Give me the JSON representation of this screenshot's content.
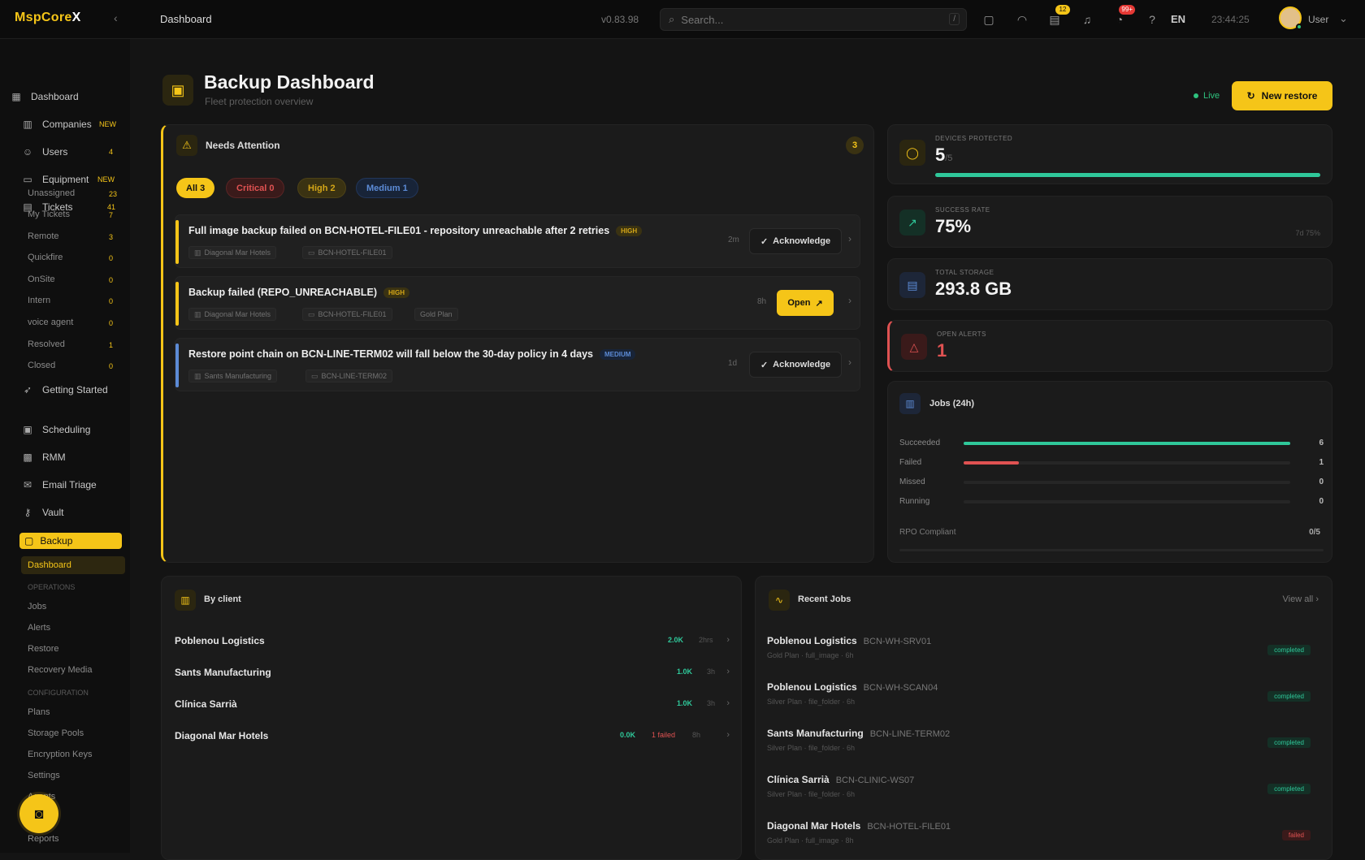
{
  "topbar": {
    "logo_prefix": "MspCore",
    "logo_suffix": "X",
    "breadcrumb": "Dashboard",
    "version": "v0.83.98",
    "search_placeholder": "Search...",
    "search_shortcut": "/",
    "badge_tickets": "12",
    "badge_alerts": "99+",
    "language": "EN",
    "clock": "23:44:25",
    "user": "User"
  },
  "sidebar": {
    "dashboard": "Dashboard",
    "companies": "Companies",
    "companies_count": "NEW",
    "users": "Users",
    "users_count": "4",
    "equipment": "Equipment",
    "equipment_count": "NEW",
    "tickets": "Tickets",
    "tickets_count": "41",
    "ticket_subs": [
      {
        "label": "Unassigned",
        "count": "23"
      },
      {
        "label": "My Tickets",
        "count": "7"
      },
      {
        "label": "Remote",
        "count": "3"
      },
      {
        "label": "Quickfire",
        "count": "0"
      },
      {
        "label": "OnSite",
        "count": "0"
      },
      {
        "label": "Intern",
        "count": "0"
      },
      {
        "label": "voice agent",
        "count": "0"
      },
      {
        "label": "Resolved",
        "count": "1"
      },
      {
        "label": "Closed",
        "count": "0"
      }
    ],
    "getting_started": "Getting Started",
    "scheduling": "Scheduling",
    "rmm": "RMM",
    "email_triage": "Email Triage",
    "vault": "Vault",
    "backup": "Backup",
    "backup_subs": {
      "dashboard": "Dashboard",
      "section_operations": "OPERATIONS",
      "jobs": "Jobs",
      "alerts": "Alerts",
      "restore": "Restore",
      "recovery_media": "Recovery Media",
      "section_configuration": "CONFIGURATION",
      "plans": "Plans",
      "storage_pools": "Storage Pools",
      "encryption_keys": "Encryption Keys",
      "settings": "Settings",
      "item_a": "Agents",
      "item_b": "Reports"
    }
  },
  "header": {
    "title": "Backup Dashboard",
    "subtitle": "Fleet protection overview",
    "live": "Live",
    "new_restore": "New restore"
  },
  "attention": {
    "title": "Needs Attention",
    "count": "3",
    "filters": {
      "all": "All 3",
      "critical": "Critical 0",
      "high": "High 2",
      "medium": "Medium 1"
    },
    "alerts": [
      {
        "title": "Full image backup failed on BCN-HOTEL-FILE01 - repository unreachable after 2 retries",
        "severity": "HIGH",
        "client": "Diagonal Mar Hotels",
        "device": "BCN-HOTEL-FILE01",
        "ago": "2m",
        "action": "Acknowledge"
      },
      {
        "title": "Backup failed (REPO_UNREACHABLE)",
        "severity": "HIGH",
        "client": "Diagonal Mar Hotels",
        "device": "BCN-HOTEL-FILE01",
        "plan": "Gold Plan",
        "ago": "8h",
        "action": "Open"
      },
      {
        "title": "Restore point chain on BCN-LINE-TERM02 will fall below the 30-day policy in 4 days",
        "severity": "MEDIUM",
        "client": "Sants Manufacturing",
        "device": "BCN-LINE-TERM02",
        "ago": "1d",
        "action": "Acknowledge"
      }
    ]
  },
  "stats": {
    "protected_label": "DEVICES PROTECTED",
    "protected_value": "5",
    "protected_total": "/5",
    "protected_progress": 1.0,
    "success_label": "SUCCESS RATE",
    "success_value": "75%",
    "success_sub": "7d 75%",
    "storage_label": "TOTAL STORAGE",
    "storage_value": "293.8 GB",
    "alerts_label": "OPEN ALERTS",
    "alerts_value": "1"
  },
  "jobs": {
    "title": "Jobs (24h)",
    "rows": [
      {
        "label": "Succeeded",
        "value": "6",
        "fraction": 1.0,
        "color": "#2fc89a"
      },
      {
        "label": "Failed",
        "value": "1",
        "fraction": 0.17,
        "color": "#e05252"
      },
      {
        "label": "Missed",
        "value": "0",
        "fraction": 0,
        "color": "#555555"
      },
      {
        "label": "Running",
        "value": "0",
        "fraction": 0,
        "color": "#555555"
      }
    ],
    "rpo_label": "RPO Compliant",
    "rpo_value": "0/5"
  },
  "clients": {
    "title": "By client",
    "rows": [
      {
        "name": "Poblenou Logistics",
        "size": "2.0K",
        "failed": "",
        "ago": "2hrs"
      },
      {
        "name": "Sants Manufacturing",
        "size": "1.0K",
        "failed": "",
        "ago": "3h"
      },
      {
        "name": "Clínica Sarrià",
        "size": "1.0K",
        "failed": "",
        "ago": "3h"
      },
      {
        "name": "Diagonal Mar Hotels",
        "size": "0.0K",
        "failed": "1 failed",
        "ago": "8h"
      }
    ]
  },
  "recent": {
    "title": "Recent Jobs",
    "view_all": "View all",
    "rows": [
      {
        "client": "Poblenou Logistics",
        "device": "BCN-WH-SRV01",
        "meta": "Gold Plan · full_image · 6h",
        "status": "completed"
      },
      {
        "client": "Poblenou Logistics",
        "device": "BCN-WH-SCAN04",
        "meta": "Silver Plan · file_folder · 6h",
        "status": "completed"
      },
      {
        "client": "Sants Manufacturing",
        "device": "BCN-LINE-TERM02",
        "meta": "Silver Plan · file_folder · 6h",
        "status": "completed"
      },
      {
        "client": "Clínica Sarrià",
        "device": "BCN-CLINIC-WS07",
        "meta": "Silver Plan · file_folder · 6h",
        "status": "completed"
      },
      {
        "client": "Diagonal Mar Hotels",
        "device": "BCN-HOTEL-FILE01",
        "meta": "Gold Plan · full_image · 8h",
        "status": "failed"
      }
    ]
  }
}
